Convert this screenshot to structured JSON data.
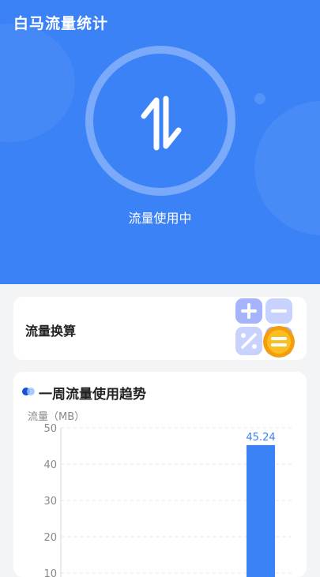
{
  "app": {
    "title": "白马流量统计"
  },
  "status": {
    "text": "流量使用中"
  },
  "convert_card": {
    "label": "流量换算"
  },
  "trend": {
    "title": "一周流量使用趋势",
    "unit_label": "流量（MB）"
  },
  "colors": {
    "primary": "#3b82f6",
    "bar": "#3b82f6"
  },
  "chart_data": {
    "type": "bar",
    "title": "一周流量使用趋势",
    "ylabel": "流量（MB）",
    "ylim": [
      0,
      50
    ],
    "yticks": [
      50,
      40,
      30,
      20,
      10
    ],
    "grid": true,
    "categories": [
      "",
      "",
      "",
      "",
      ""
    ],
    "values": [
      0,
      0,
      0,
      0,
      45.24
    ],
    "data_labels": [
      "",
      "",
      "",
      "",
      "45.24"
    ]
  }
}
